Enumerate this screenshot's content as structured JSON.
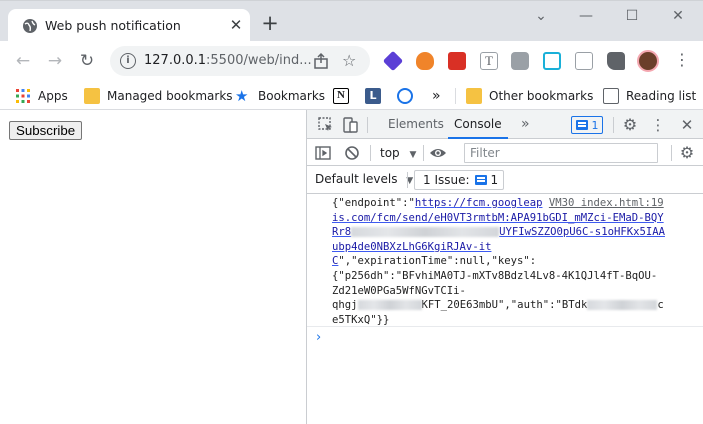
{
  "tab": {
    "title": "Web push notification",
    "close_icon": "close-icon",
    "new_tab": "+"
  },
  "window_controls": {
    "minimize": "—",
    "maximize": "☐",
    "close": "✕",
    "tabsearch": "⌄"
  },
  "omnibox": {
    "url_host": "127.0.0.1",
    "url_rest": ":5500/web/ind..."
  },
  "bookmarks": {
    "apps": "Apps",
    "managed": "Managed bookmarks",
    "bookmarks": "Bookmarks",
    "more": "»",
    "other": "Other bookmarks",
    "reading_list": "Reading list"
  },
  "page": {
    "subscribe_label": "Subscribe"
  },
  "devtools": {
    "tabs": {
      "elements": "Elements",
      "console": "Console",
      "more": "»"
    },
    "issue_count": "1",
    "context": "top",
    "filter_placeholder": "Filter",
    "default_levels": "Default levels",
    "issues_label": "1 Issue:",
    "issues_count": "1",
    "log": {
      "l1_a": "{\"endpoint\":\"",
      "l1_link": "https://fcm.googleap",
      "l1_src": "VM30 index.html:19",
      "l2": "is.com/fcm/send/eH0VT3rmtbM:APA91bGDI_mMZci-EMaD-BQY",
      "l3_a": "Rr8",
      "l3_b": "UYFIwSZZO0pU6C-s1oHFKx5IAA",
      "l4": "ubp4de0NBXzLhG6KgiRJAv-it",
      "l5_a": "C",
      "l5_b": "\",\"expirationTime\":null,\"keys\":",
      "l6": "{\"p256dh\":\"BFvhiMA0TJ-mXTv8Bdzl4Lv8-4K1QJl4fT-BqOU-",
      "l7": "Zd21eW0PGa5WfNGvTCIi-",
      "l8_a": "qhgj",
      "l8_b": "KFT_20E63mbU\",\"auth\":\"BTdk",
      "l8_c": "c",
      "l9": "e5TKxQ\"}}"
    },
    "prompt": "›"
  },
  "colors": {
    "accent": "#1a73e8",
    "link": "#1a1aa6"
  }
}
